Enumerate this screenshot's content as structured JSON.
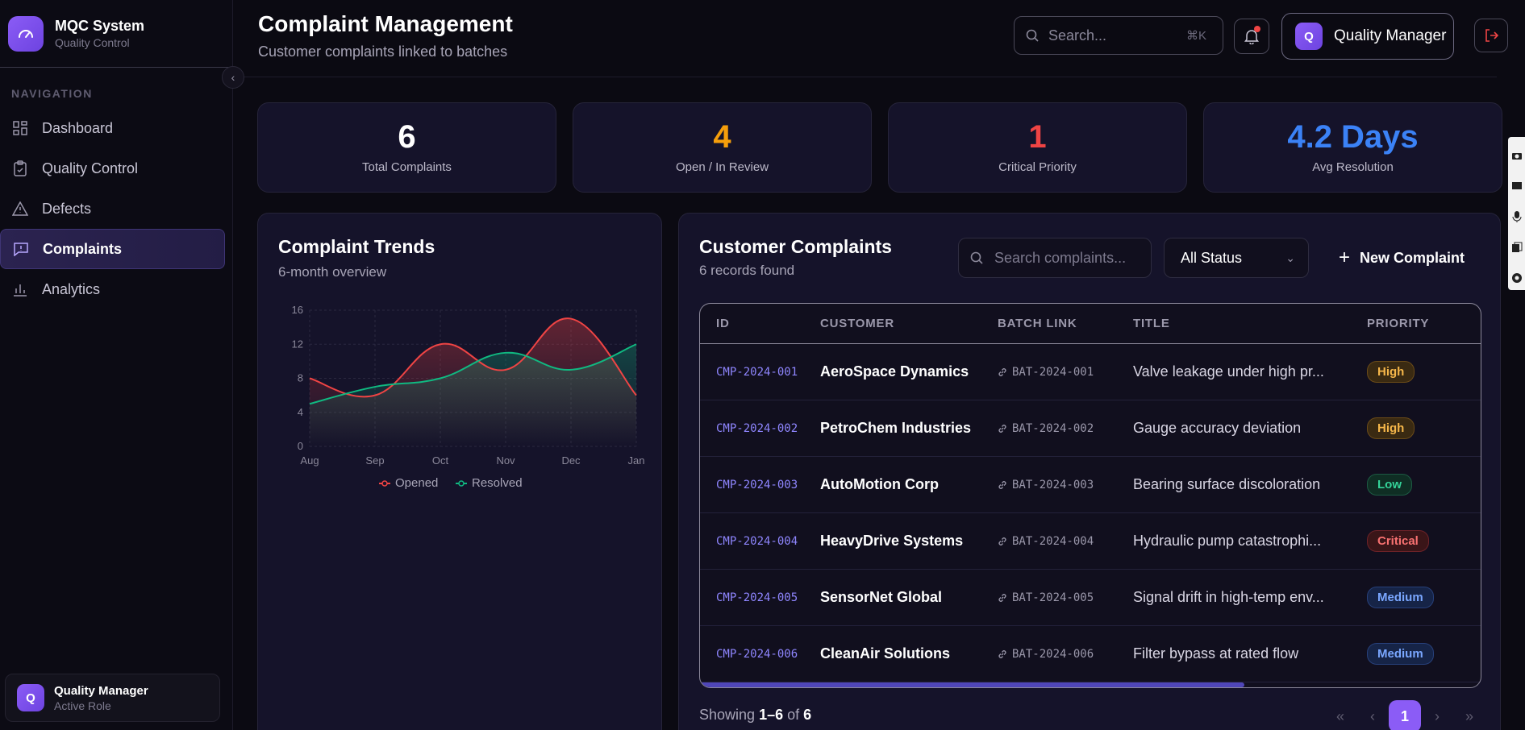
{
  "app": {
    "name": "MQC System",
    "subtitle": "Quality Control"
  },
  "sidebar": {
    "heading": "NAVIGATION",
    "items": [
      {
        "label": "Dashboard",
        "icon": "grid-icon",
        "active": false
      },
      {
        "label": "Quality Control",
        "icon": "clipboard-check-icon",
        "active": false
      },
      {
        "label": "Defects",
        "icon": "warning-icon",
        "active": false
      },
      {
        "label": "Complaints",
        "icon": "message-alert-icon",
        "active": true
      },
      {
        "label": "Analytics",
        "icon": "bar-chart-icon",
        "active": false
      }
    ],
    "user": {
      "initial": "Q",
      "name": "Quality Manager",
      "role": "Active Role"
    }
  },
  "header": {
    "title": "Complaint Management",
    "subtitle": "Customer complaints linked to batches",
    "search_placeholder": "Search...",
    "search_shortcut": "⌘K",
    "role": {
      "initial": "Q",
      "label": "Quality Manager"
    }
  },
  "stats": [
    {
      "value": "6",
      "label": "Total Complaints",
      "color": "#ffffff"
    },
    {
      "value": "4",
      "label": "Open / In Review",
      "color": "#f59e0b"
    },
    {
      "value": "1",
      "label": "Critical Priority",
      "color": "#ef4444"
    },
    {
      "value": "4.2 Days",
      "label": "Avg Resolution",
      "color": "#3b82f6"
    }
  ],
  "trend": {
    "title": "Complaint Trends",
    "subtitle": "6-month overview"
  },
  "chart_data": {
    "type": "line",
    "categories": [
      "Aug",
      "Sep",
      "Oct",
      "Nov",
      "Dec",
      "Jan"
    ],
    "series": [
      {
        "name": "Opened",
        "values": [
          8,
          6,
          12,
          9,
          15,
          6
        ],
        "color": "#ef4444"
      },
      {
        "name": "Resolved",
        "values": [
          5,
          7,
          8,
          11,
          9,
          12
        ],
        "color": "#10b981"
      }
    ],
    "yticks": [
      "0",
      "4",
      "8",
      "12",
      "16"
    ],
    "ylim": [
      0,
      16
    ],
    "grid": true,
    "legend": "bottom"
  },
  "table": {
    "title": "Customer Complaints",
    "count_text": "6 records found",
    "search_placeholder": "Search complaints...",
    "status_filter": "All Status",
    "new_button": "New Complaint",
    "columns": [
      "ID",
      "CUSTOMER",
      "BATCH LINK",
      "TITLE",
      "PRIORITY"
    ],
    "rows": [
      {
        "id": "CMP-2024-001",
        "customer": "AeroSpace Dynamics",
        "batch": "BAT-2024-001",
        "title": "Valve leakage under high pr...",
        "priority": "High"
      },
      {
        "id": "CMP-2024-002",
        "customer": "PetroChem Industries",
        "batch": "BAT-2024-002",
        "title": "Gauge accuracy deviation",
        "priority": "High"
      },
      {
        "id": "CMP-2024-003",
        "customer": "AutoMotion Corp",
        "batch": "BAT-2024-003",
        "title": "Bearing surface discoloration",
        "priority": "Low"
      },
      {
        "id": "CMP-2024-004",
        "customer": "HeavyDrive Systems",
        "batch": "BAT-2024-004",
        "title": "Hydraulic pump catastrophi...",
        "priority": "Critical"
      },
      {
        "id": "CMP-2024-005",
        "customer": "SensorNet Global",
        "batch": "BAT-2024-005",
        "title": "Signal drift in high-temp env...",
        "priority": "Medium"
      },
      {
        "id": "CMP-2024-006",
        "customer": "CleanAir Solutions",
        "batch": "BAT-2024-006",
        "title": "Filter bypass at rated flow",
        "priority": "Medium"
      }
    ],
    "priority_colors": {
      "High": {
        "fg": "#f5b64a",
        "bg": "#3a2a12",
        "border": "#6b4b18"
      },
      "Low": {
        "fg": "#34d399",
        "bg": "#0f2e24",
        "border": "#1d5a43"
      },
      "Critical": {
        "fg": "#f87171",
        "bg": "#3a1518",
        "border": "#6e2228"
      },
      "Medium": {
        "fg": "#7aa7ff",
        "bg": "#162447",
        "border": "#27407a"
      }
    },
    "footer": {
      "prefix": "Showing",
      "range": "1–6",
      "of": "of",
      "total": "6"
    },
    "pagination": {
      "current": "1",
      "first": "«",
      "prev": "‹",
      "next": "›",
      "last": "»"
    }
  }
}
